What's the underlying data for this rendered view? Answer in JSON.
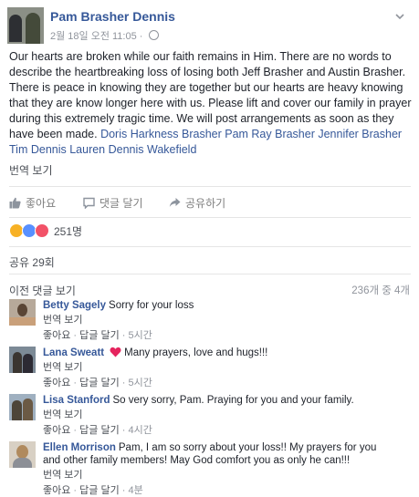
{
  "post": {
    "author": "Pam Brasher Dennis",
    "timestamp": "2월 18일 오전 11:05",
    "body": "Our hearts are broken while our faith remains in Him. There are no words to describe the heartbreaking loss of losing both Jeff Brasher and Austin Brasher. There is peace in knowing they are together but our hearts are heavy knowing that they are know longer here with us. Please lift and cover our family in prayer during this extremely tragic time. We will post arrangements as soon as they have been made. ",
    "tags": "Doris Harkness Brasher Pam Ray Brasher Jennifer Brasher Tim Dennis Lauren Dennis Wakefield",
    "see_translation": "번역 보기"
  },
  "actions": {
    "like": "좋아요",
    "comment": "댓글 달기",
    "share": "공유하기"
  },
  "reactions": {
    "count": "251명"
  },
  "shares": "공유 29회",
  "comments_header": {
    "previous": "이전 댓글 보기",
    "count": "236개 중 4개"
  },
  "comments": [
    {
      "name": "Betty Sagely",
      "text": "Sorry for your loss",
      "see_translation": "번역 보기",
      "like": "좋아요",
      "reply": "답글 달기",
      "time": "5시간"
    },
    {
      "name": "Lana Sweatt",
      "text": "Many prayers, love and hugs!!!",
      "see_translation": "번역 보기",
      "like": "좋아요",
      "reply": "답글 달기",
      "time": "5시간"
    },
    {
      "name": "Lisa Stanford",
      "text": "So very sorry, Pam. Praying for you and your family.",
      "see_translation": "번역 보기",
      "like": "좋아요",
      "reply": "답글 달기",
      "time": "4시간"
    },
    {
      "name": "Ellen Morrison",
      "text": "Pam, I am so sorry about your loss!! My prayers for you and other family members! May God comfort you as only he can!!!",
      "see_translation": "번역 보기",
      "like": "좋아요",
      "reply": "답글 달기",
      "time": "4분"
    }
  ],
  "colors": {
    "link": "#365899",
    "text": "#1d2129",
    "meta": "#90949c",
    "heart": "#e5245e"
  }
}
